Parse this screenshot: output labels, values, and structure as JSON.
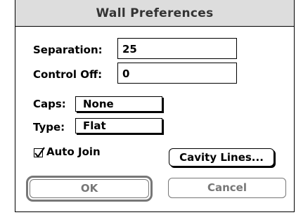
{
  "dialog": {
    "title": "Wall Preferences",
    "separation_label": "Separation:",
    "separation_value": "25",
    "control_off_label": "Control Off:",
    "control_off_value": "0",
    "caps_label": "Caps:",
    "caps_value": "None",
    "type_label": "Type:",
    "type_value": "Flat",
    "auto_join_label": "Auto Join",
    "auto_join_checked": true,
    "cavity_lines_label": "Cavity Lines...",
    "ok_label": "OK",
    "cancel_label": "Cancel"
  }
}
